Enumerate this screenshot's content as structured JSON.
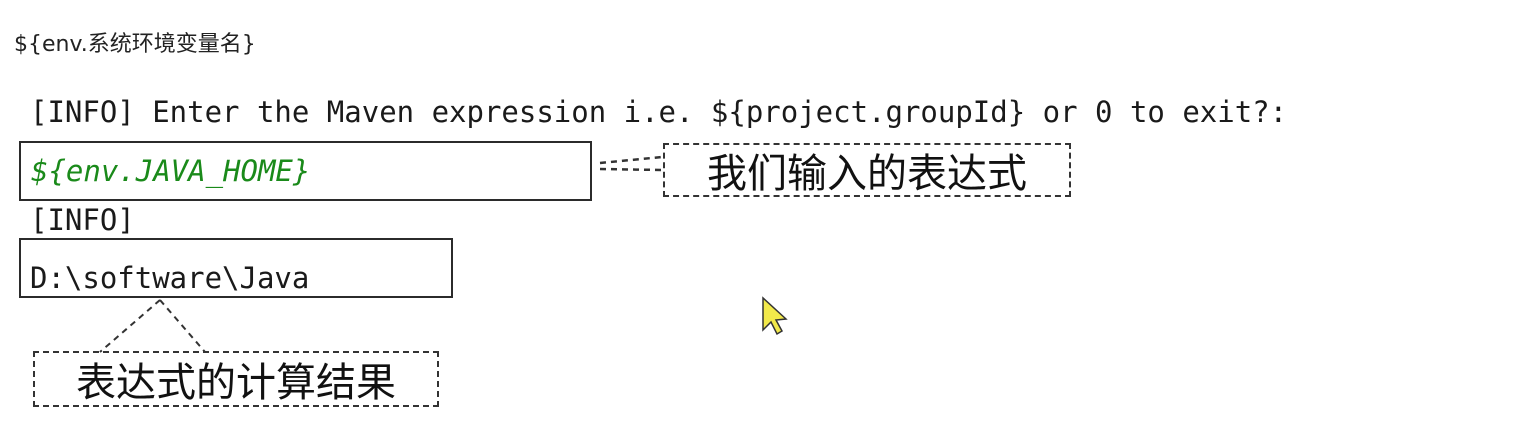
{
  "heading": "${env.系统环境变量名}",
  "console": {
    "prompt_line": "[INFO] Enter the Maven expression i.e. ${project.groupId} or 0 to exit?:",
    "input_expression": "${env.JAVA_HOME}",
    "info_line": "[INFO]",
    "result_value": "D:\\software\\Java"
  },
  "callouts": {
    "input_label": "我们输入的表达式",
    "result_label": "表达式的计算结果"
  },
  "colors": {
    "expression_text": "#1a8a1a",
    "cursor_fill": "#f2e94a"
  },
  "icons": {
    "cursor": "mouse-pointer-icon"
  }
}
